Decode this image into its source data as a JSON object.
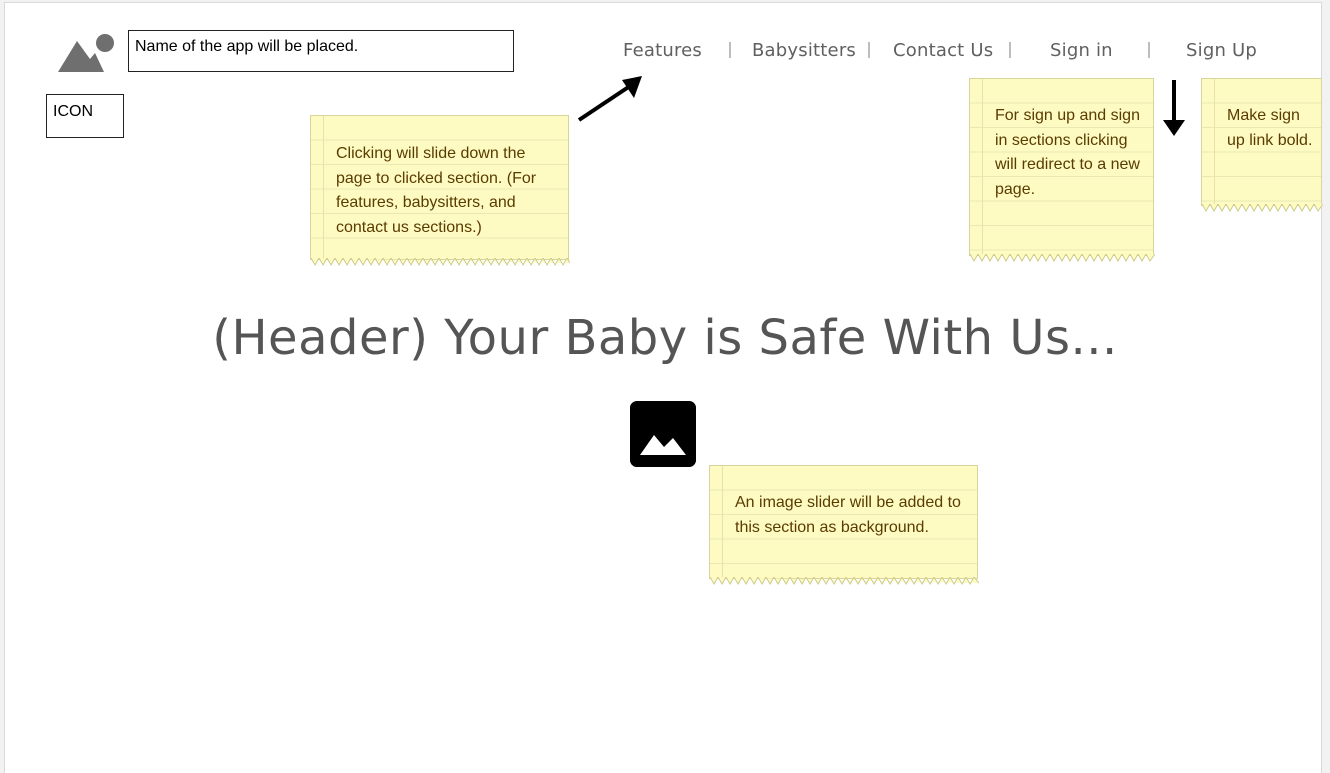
{
  "app": {
    "name_placeholder": "Name of the app will be placed.",
    "icon_label": "ICON"
  },
  "nav": {
    "items": [
      {
        "label": "Features"
      },
      {
        "label": "Babysitters"
      },
      {
        "label": "Contact Us"
      },
      {
        "label": "Sign in"
      },
      {
        "label": "Sign Up"
      }
    ]
  },
  "notes": {
    "scroll_note": "Clicking will slide down the page to clicked section. (For features, babysitters, and contact us sections.)",
    "auth_note": "For sign up and sign in sections clicking will redirect to a new page.",
    "bold_note": "Make sign up link bold.",
    "slider_note": "An image slider will be added to this section as background."
  },
  "hero": {
    "headline": "(Header) Your Baby is Safe With Us..."
  },
  "colors": {
    "note_bg": "#fdfbc2",
    "note_text": "#5a3b00",
    "nav_text": "#606060",
    "headline": "#555555"
  },
  "icons": [
    "image-placeholder-icon",
    "logo-image-icon",
    "arrow-icon"
  ]
}
